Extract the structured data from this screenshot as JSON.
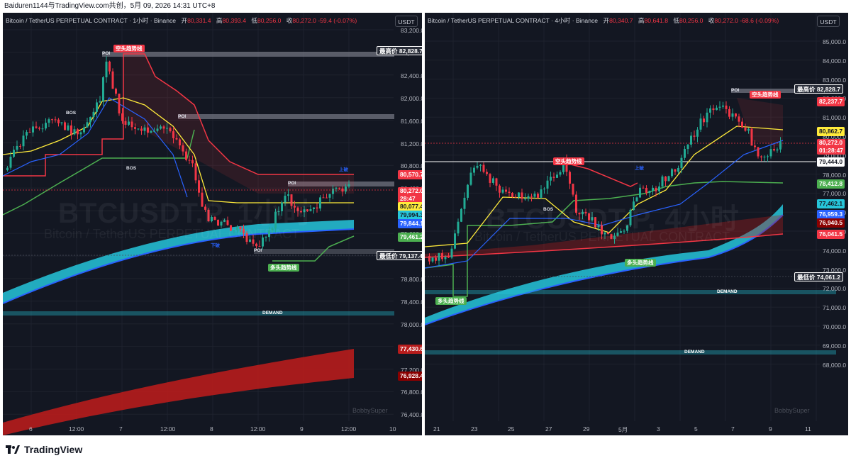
{
  "top_caption": "Baiduren1144与TradingView.com共创，5月 09, 2026 14:31 UTC+8",
  "footer_logo": "TradingView",
  "left": {
    "header": {
      "symbol": "Bitcoin / TetherUS PERPETUAL CONTRACT · 1小时 · Binance",
      "open_label": "开",
      "open": "80,331.4",
      "high_label": "高",
      "high": "80,393.4",
      "low_label": "低",
      "low": "80,256.0",
      "close_label": "收",
      "close": "80,272.0",
      "change": "-59.4 (-0.07%)"
    },
    "currency": "USDT",
    "watermark": "BTCUSDT.P, 1小时",
    "watermark_sub": "Bitcoin / TetherUS PERPETUAL CONTRACT",
    "signature": "BobbySuper",
    "y_ticks": [
      "83,200.0",
      "82,800.0",
      "82,400.0",
      "82,000.0",
      "81,600.0",
      "81,200.0",
      "80,800.0",
      "80,400.0",
      "80,000.0",
      "79,600.0",
      "79,200.0",
      "78,800.0",
      "78,400.0",
      "78,000.0",
      "77,600.0",
      "77,200.0",
      "76,800.0",
      "76,400.0"
    ],
    "x_ticks": [
      "6",
      "12:00",
      "7",
      "12:00",
      "8",
      "12:00",
      "9",
      "12:00",
      "10"
    ],
    "price_tags": {
      "high_tag_label": "最高价",
      "high_tag": "82,828.7",
      "p1": "80,570.7",
      "close": "80,272.0",
      "countdown": "28:47",
      "p2": "80,077.4",
      "p3": "79,994.3",
      "p4": "79,844.1",
      "p5": "79,461.2",
      "low_tag_label": "最低价",
      "low_tag": "79,137.4",
      "p6": "77,430.6",
      "p7": "76,928.4"
    },
    "labels": {
      "bear_trend": "空头趋势线",
      "bull_trend": "多头趋势线",
      "poi": "POI",
      "bos": "BOS",
      "demand": "DEMAND",
      "upline": "上破",
      "downline": "下破"
    }
  },
  "right": {
    "header": {
      "symbol": "Bitcoin / TetherUS PERPETUAL CONTRACT · 4小时 · Binance",
      "open_label": "开",
      "open": "80,340.7",
      "high_label": "高",
      "high": "80,641.8",
      "low_label": "低",
      "low": "80,256.0",
      "close_label": "收",
      "close": "80,272.0",
      "change": "-68.6 (-0.09%)"
    },
    "currency": "USDT",
    "watermark": "BTCUSDT.P, 4小时",
    "watermark_sub": "Bitcoin / TetherUS PERPETUAL CONTRACT",
    "signature": "BobbySuper",
    "y_ticks": [
      "85,000.0",
      "84,000.0",
      "83,000.0",
      "82,000.0",
      "81,000.0",
      "80,000.0",
      "79,000.0",
      "78,000.0",
      "77,000.0",
      "76,000.0",
      "75,000.0",
      "74,000.0",
      "73,000.0",
      "72,000.0",
      "71,000.0",
      "70,000.0",
      "69,000.0",
      "68,000.0"
    ],
    "x_ticks": [
      "21",
      "23",
      "25",
      "27",
      "29",
      "5月",
      "3",
      "5",
      "7",
      "9",
      "11"
    ],
    "price_tags": {
      "high_tag_label": "最高价",
      "high_tag": "82,828.7",
      "p1": "82,237.7",
      "p2": "80,862.7",
      "close": "80,272.0",
      "countdown": "01:28:47",
      "p3": "79,444.0",
      "p4": "78,412.8",
      "p5": "77,462.1",
      "p6": "76,959.3",
      "p7": "76,940.5",
      "p8": "76,041.5",
      "low_tag_label": "最低价",
      "low_tag": "74,061.2"
    },
    "labels": {
      "bear_trend": "空头趋势线",
      "bull_trend": "多头趋势线",
      "poi": "POI",
      "bos": "BOS",
      "demand": "DEMAND",
      "upline": "上破"
    }
  },
  "colors": {
    "bg": "#131722",
    "up": "#22ab94",
    "down": "#f23645",
    "supertrend_up": "#4caf50",
    "supertrend_down": "#f23645",
    "ema_band": "#26c6da",
    "yellow": "#ffeb3b",
    "blue": "#2962ff"
  }
}
